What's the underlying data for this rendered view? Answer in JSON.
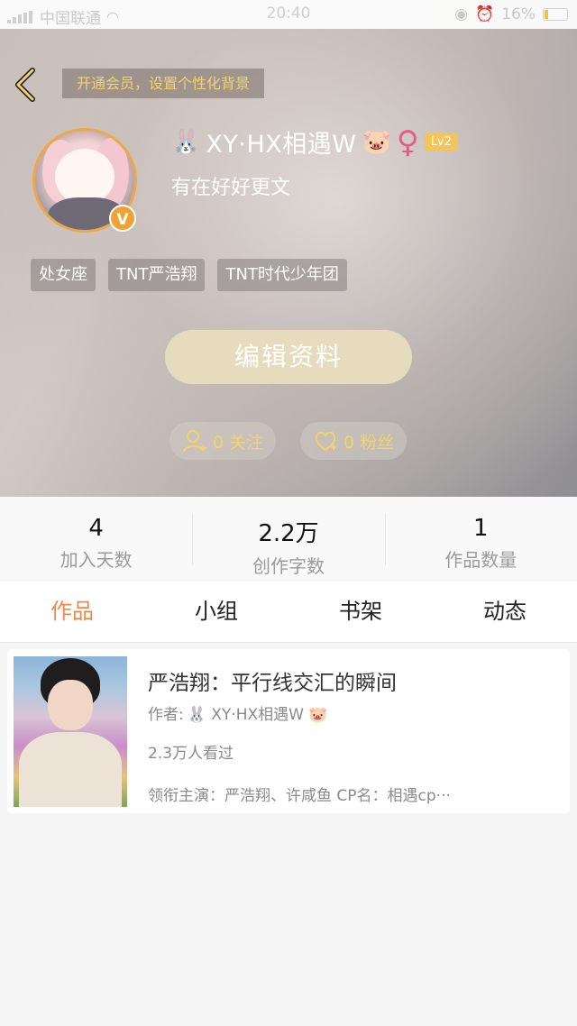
{
  "status_bar": {
    "carrier": "中国联通",
    "time": "20:40",
    "battery_percent": "16%"
  },
  "header": {
    "background_hint": "开通会员，设置个性化背景"
  },
  "profile": {
    "name": "XY·HX相遇W",
    "name_prefix_emoji": "🐰",
    "name_suffix_emoji": "🐷",
    "gender_symbol": "♀",
    "level": "Lv2",
    "vip_badge": "V",
    "signature": "有在好好更文",
    "tags": [
      "处女座",
      "TNT严浩翔",
      "TNT时代少年团"
    ],
    "edit_button": "编辑资料",
    "following": "0 关注",
    "followers": "0 粉丝"
  },
  "stats": [
    {
      "value": "4",
      "label": "加入天数"
    },
    {
      "value": "2.2万",
      "label": "创作字数"
    },
    {
      "value": "1",
      "label": "作品数量"
    }
  ],
  "tabs": [
    {
      "label": "作品",
      "active": true
    },
    {
      "label": "小组",
      "active": false
    },
    {
      "label": "书架",
      "active": false
    },
    {
      "label": "动态",
      "active": false
    }
  ],
  "works": [
    {
      "title": "严浩翔：平行线交汇的瞬间",
      "author_label": "作者:",
      "author": "🐰 XY·HX相遇W 🐷",
      "views": "2.3万人看过",
      "cast": "领衔主演：严浩翔、许咸鱼 CP名：相遇cp···"
    }
  ],
  "colors": {
    "accent": "#ee8a48",
    "gold": "#f2d36b",
    "edit_button_bg": "#e6dcbd",
    "female": "#e85a88"
  }
}
